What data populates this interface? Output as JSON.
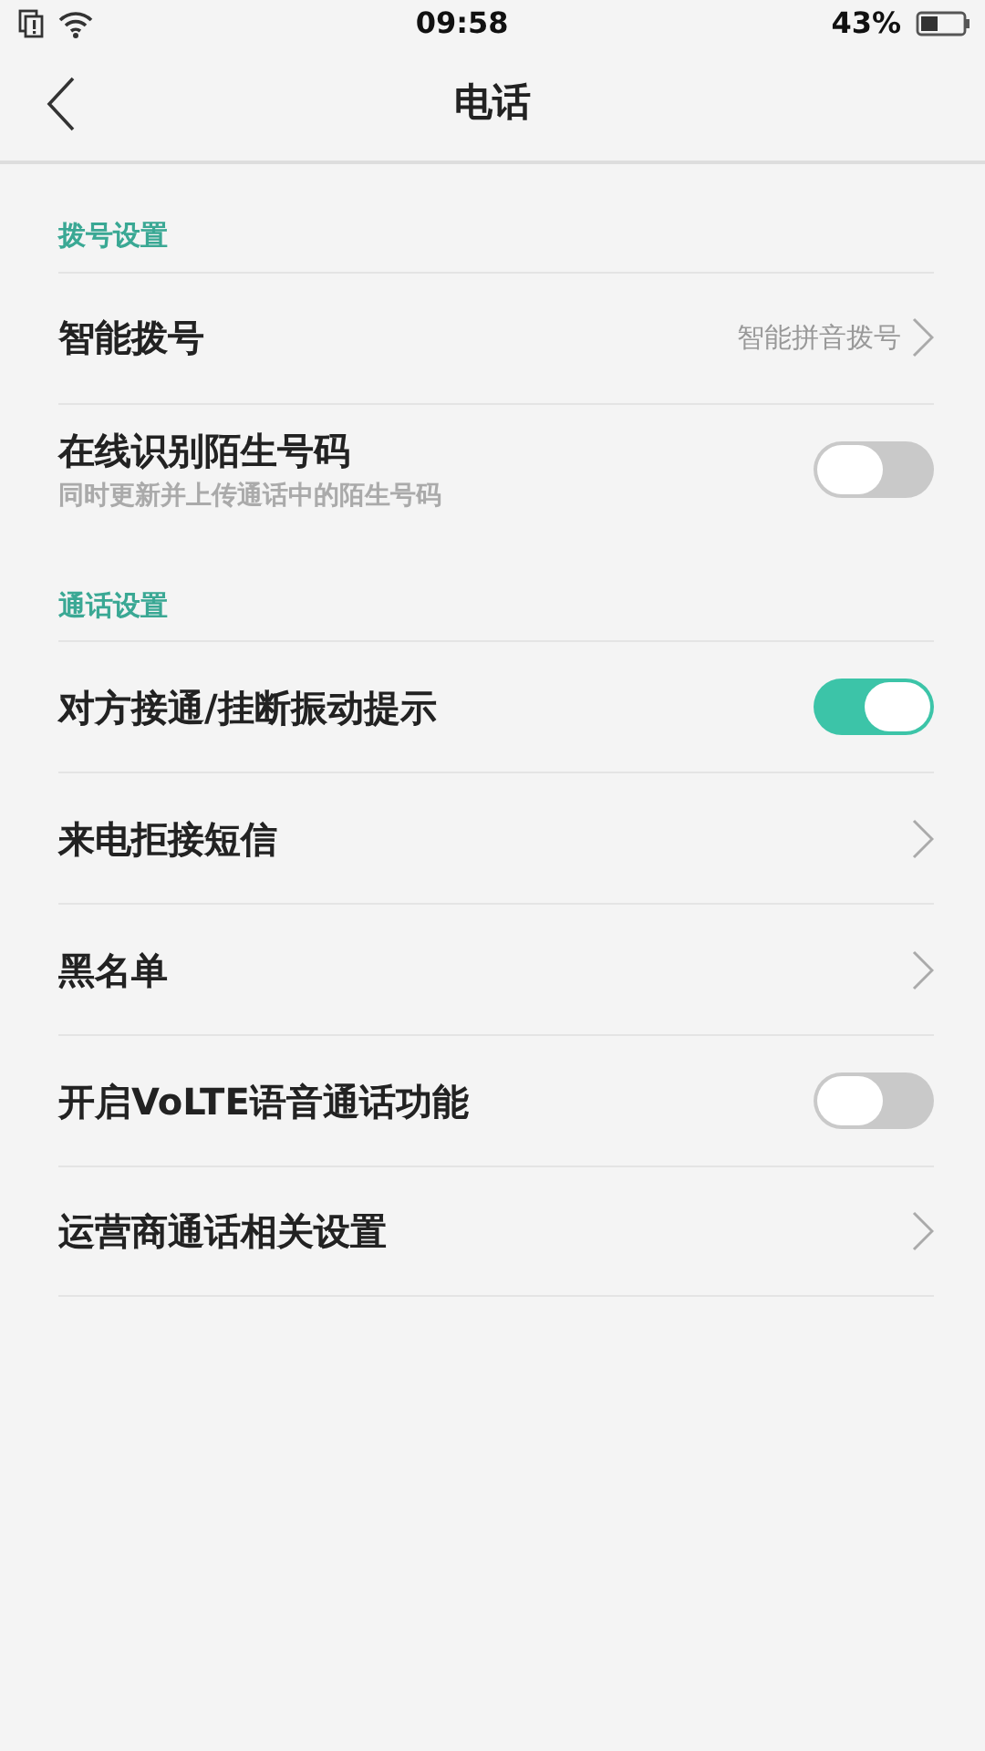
{
  "status_bar": {
    "time": "09:58",
    "battery_text": "43%"
  },
  "header": {
    "title": "电话"
  },
  "sections": [
    {
      "title": "拨号设置",
      "items": [
        {
          "kind": "link",
          "label": "智能拨号",
          "value": "智能拼音拨号"
        },
        {
          "kind": "toggle",
          "label": "在线识别陌生号码",
          "subtitle": "同时更新并上传通话中的陌生号码",
          "on": false
        }
      ]
    },
    {
      "title": "通话设置",
      "items": [
        {
          "kind": "toggle",
          "label": "对方接通/挂断振动提示",
          "on": true
        },
        {
          "kind": "link",
          "label": "来电拒接短信"
        },
        {
          "kind": "link",
          "label": "黑名单"
        },
        {
          "kind": "toggle",
          "label": "开启VoLTE语音通话功能",
          "on": false
        },
        {
          "kind": "link",
          "label": "运营商通话相关设置"
        }
      ]
    }
  ]
}
